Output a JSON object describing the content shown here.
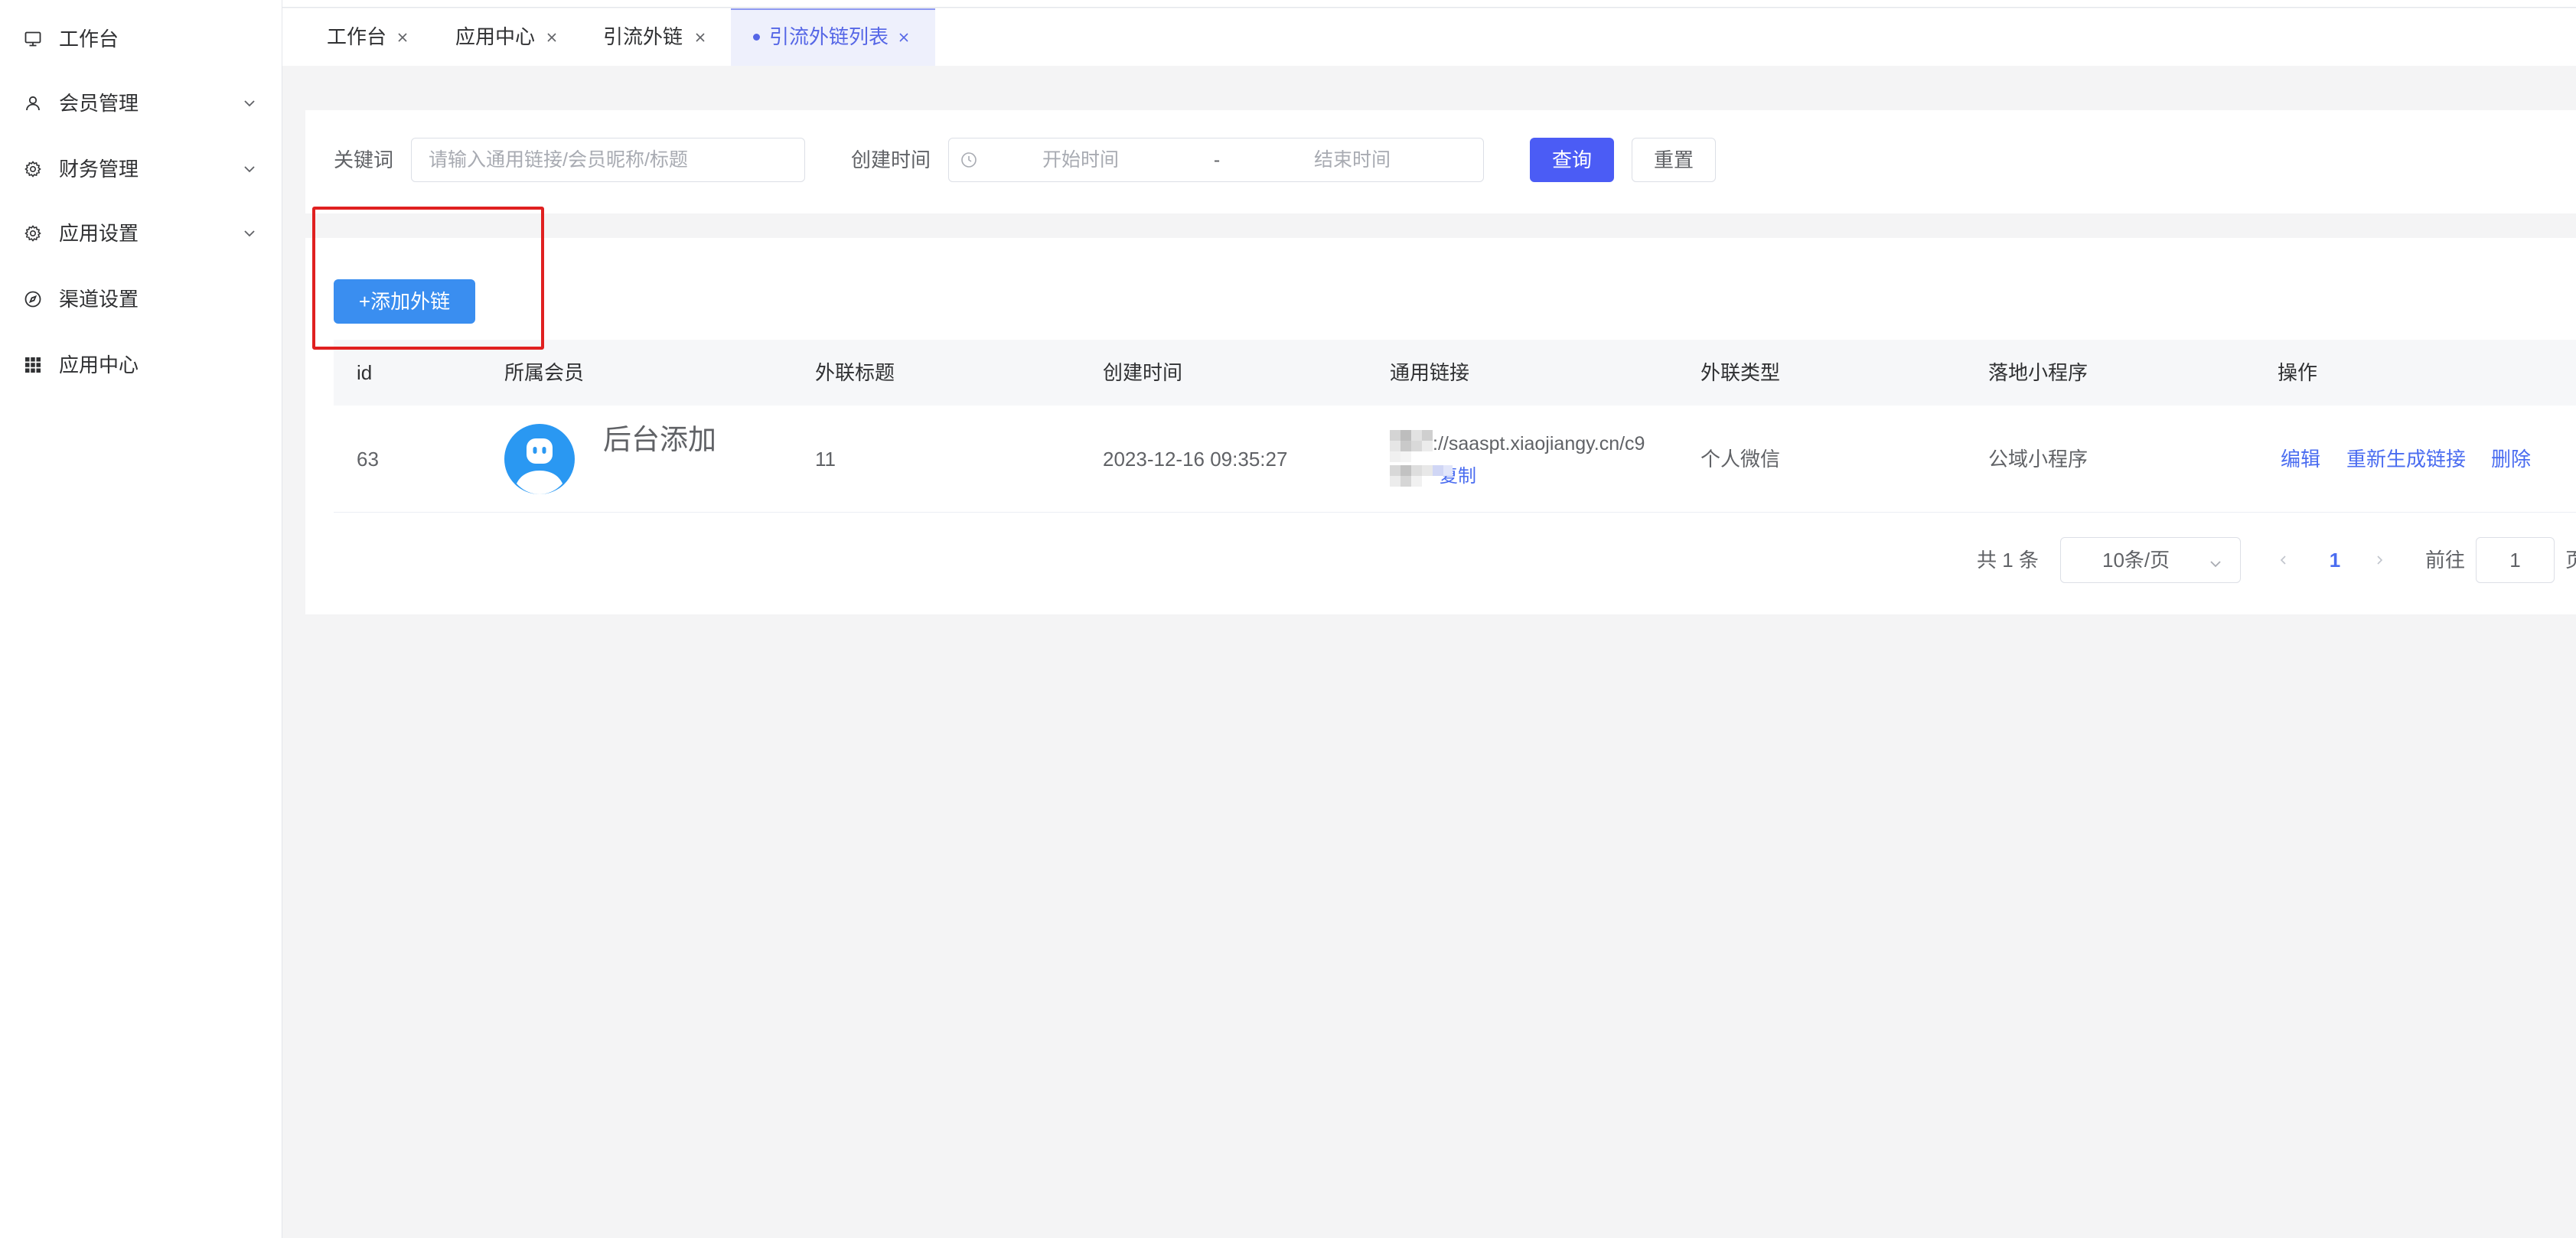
{
  "colors": {
    "primary": "#4b5cf5",
    "add_button": "#3a8ef0",
    "link": "#4a6cf0",
    "highlight": "#e02020",
    "page_bg": "#f4f4f5",
    "active_tab_bg": "#eef0fc"
  },
  "sidebar": {
    "items": [
      {
        "label": "工作台",
        "icon": "monitor-icon",
        "expandable": false
      },
      {
        "label": "会员管理",
        "icon": "user-icon",
        "expandable": true
      },
      {
        "label": "财务管理",
        "icon": "gear-icon",
        "expandable": true
      },
      {
        "label": "应用设置",
        "icon": "gear-icon",
        "expandable": true
      },
      {
        "label": "渠道设置",
        "icon": "compass-icon",
        "expandable": false
      },
      {
        "label": "应用中心",
        "icon": "grid-icon",
        "expandable": false
      }
    ]
  },
  "tabs": [
    {
      "label": "工作台",
      "active": false
    },
    {
      "label": "应用中心",
      "active": false
    },
    {
      "label": "引流外链",
      "active": false
    },
    {
      "label": "引流外链列表",
      "active": true
    }
  ],
  "filters": {
    "keyword_label": "关键词",
    "keyword_placeholder": "请输入通用链接/会员昵称/标题",
    "created_label": "创建时间",
    "start_placeholder": "开始时间",
    "range_separator": "-",
    "end_placeholder": "结束时间",
    "search_button": "查询",
    "reset_button": "重置"
  },
  "toolbar": {
    "add_button": "+添加外链"
  },
  "table": {
    "columns": [
      "id",
      "所属会员",
      "外联标题",
      "创建时间",
      "通用链接",
      "外联类型",
      "落地小程序",
      "操作"
    ],
    "rows": [
      {
        "id": "63",
        "member": "后台添加",
        "title": "11",
        "created": "2023-12-16 09:35:27",
        "link": "://saaspt.xiaojiangy.cn/c9",
        "copy": "复制",
        "type": "个人微信",
        "miniprogram": "公域小程序",
        "actions": [
          "编辑",
          "重新生成链接",
          "删除"
        ]
      }
    ]
  },
  "pagination": {
    "total": "共 1 条",
    "page_size": "10条/页",
    "current_page": "1",
    "goto_label": "前往",
    "goto_value": "1",
    "page_suffix": "页"
  }
}
